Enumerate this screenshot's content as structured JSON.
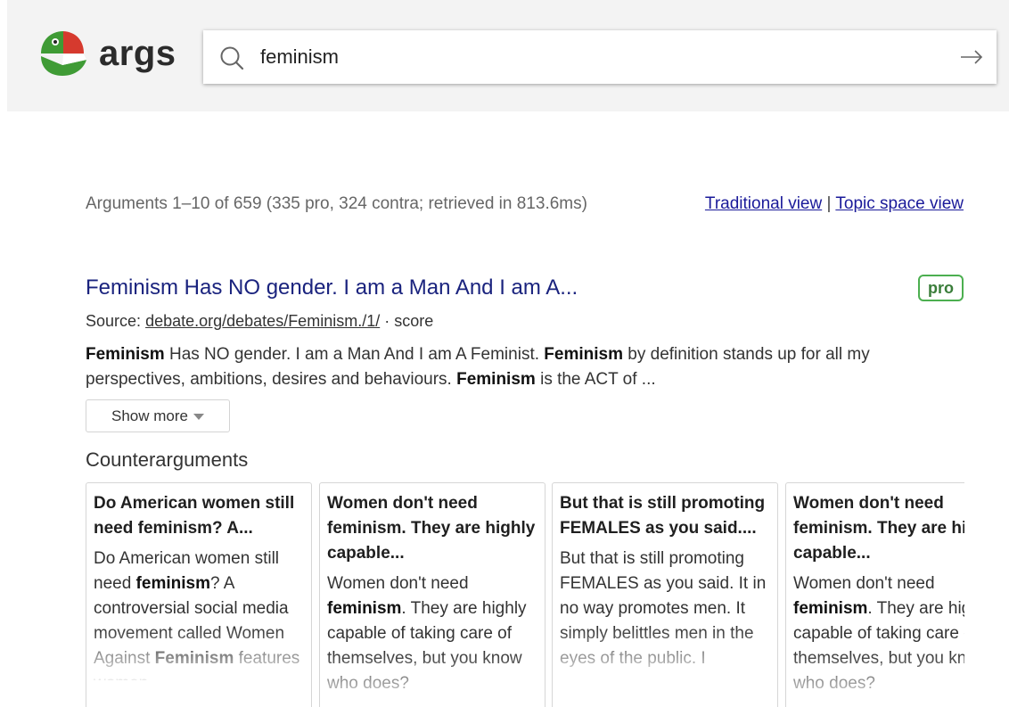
{
  "brand": {
    "name": "args"
  },
  "search": {
    "value": "feminism"
  },
  "summary": "Arguments 1–10 of 659 (335 pro, 324 contra; retrieved in 813.6ms)",
  "views": {
    "traditional": "Traditional view",
    "separator": "|",
    "topic": "Topic space view"
  },
  "result": {
    "title": "Feminism Has NO gender. I am a Man And I am A...",
    "stance": "pro",
    "source_label": "Source:",
    "source_link": "debate.org/debates/Feminism./1/",
    "source_suffix": "· score",
    "snippet": [
      {
        "text": "Feminism",
        "bold": true
      },
      {
        "text": " Has NO gender. I am a Man And I am A Feminist. ",
        "bold": false
      },
      {
        "text": "Feminism",
        "bold": true
      },
      {
        "text": " by definition stands up for all my perspectives, ambitions, desires and behaviours. ",
        "bold": false
      },
      {
        "text": "Feminism",
        "bold": true
      },
      {
        "text": " is the ACT of ...",
        "bold": false
      }
    ],
    "show_more": "Show more"
  },
  "counterarguments": {
    "heading": "Counterarguments",
    "cards": [
      {
        "title": "Do American women still need feminism? A...",
        "body": [
          {
            "text": "Do American women still need ",
            "bold": false
          },
          {
            "text": "feminism",
            "bold": true
          },
          {
            "text": "? A controversial social media movement called Women Against ",
            "bold": false
          },
          {
            "text": "Feminism",
            "bold": true
          },
          {
            "text": " features women",
            "bold": false
          }
        ]
      },
      {
        "title": "Women don't need feminism. They are highly capable...",
        "body": [
          {
            "text": "Women don't need ",
            "bold": false
          },
          {
            "text": "feminism",
            "bold": true
          },
          {
            "text": ". They are highly capable of taking care of themselves, but you know who does?",
            "bold": false
          }
        ]
      },
      {
        "title": "But that is still promoting FEMALES as you said....",
        "body": [
          {
            "text": "But that is still promoting FEMALES as you said. It in no way promotes men. It simply belittles men in the eyes of the public. I",
            "bold": false
          }
        ]
      },
      {
        "title": "Women don't need feminism. They are highly capable...",
        "body": [
          {
            "text": "Women don't need ",
            "bold": false
          },
          {
            "text": "feminism",
            "bold": true
          },
          {
            "text": ". They are highly capable of taking care of themselves, but you know who does?",
            "bold": false
          }
        ]
      }
    ]
  },
  "colors": {
    "title_link": "#1a237e",
    "pro_badge": "#4caf50",
    "logo_green": "#3f9b35",
    "logo_red": "#d63a2e"
  }
}
